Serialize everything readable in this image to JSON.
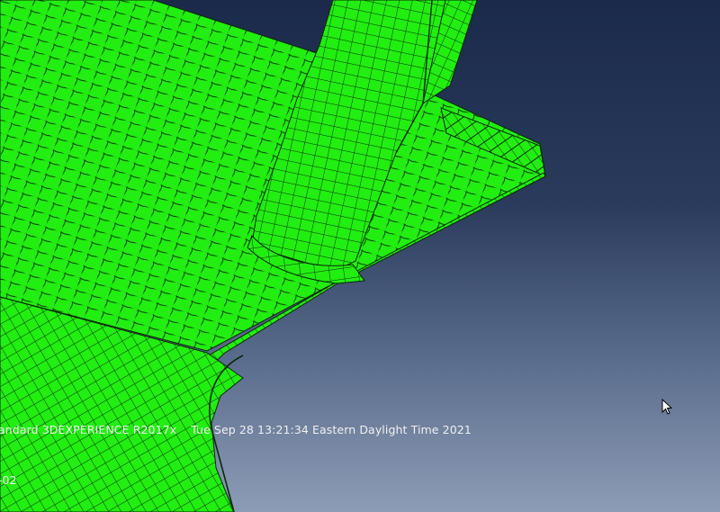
{
  "viewport": {
    "background_top": "#1b2a4a",
    "background_bottom": "#8d9cb6",
    "mesh_color": "#22ee11",
    "mesh_line_color": "#0a2a06"
  },
  "info": {
    "product_line": "andard 3DEXPERIENCE R2017x",
    "timestamp": "Tue Sep 28 13:21:34 Eastern Daylight Time 2021",
    "second_line": "-02"
  },
  "cursor": {
    "icon": "mouse-pointer-icon"
  }
}
